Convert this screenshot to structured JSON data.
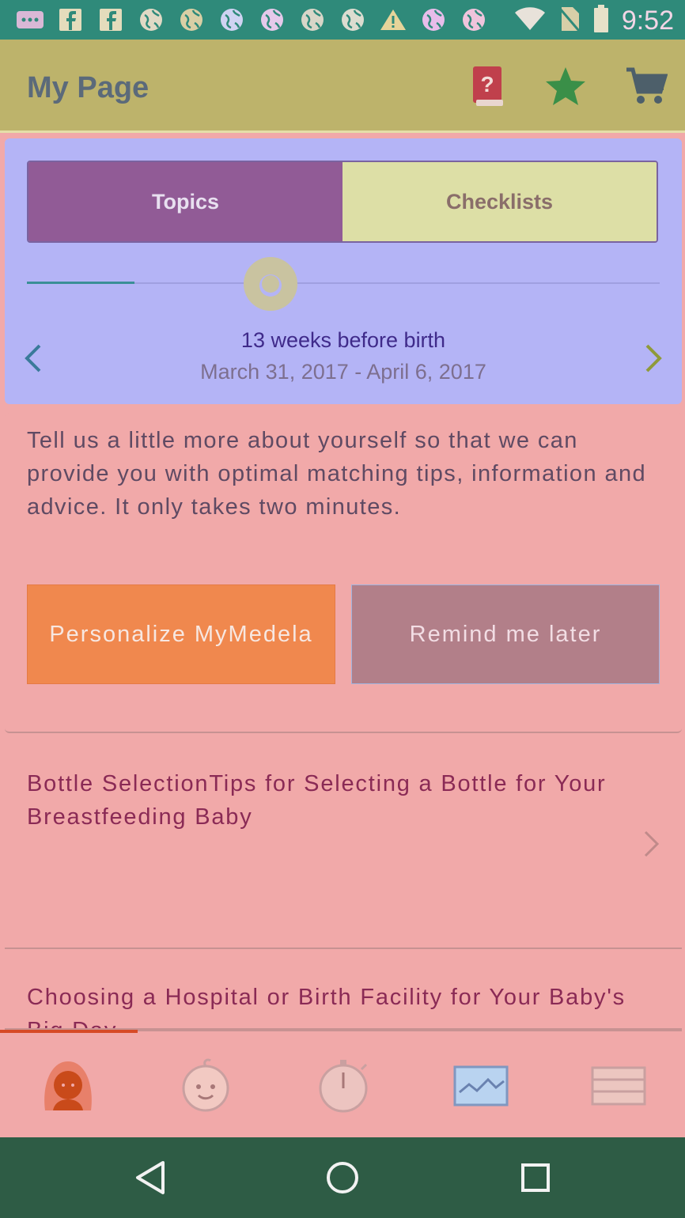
{
  "status_bar": {
    "time": "9:52",
    "icons": [
      "message-icon",
      "facebook-icon",
      "facebook-icon",
      "globe-icon",
      "globe-icon",
      "globe-icon",
      "globe-icon",
      "globe-icon",
      "globe-icon",
      "warning-icon",
      "globe-icon",
      "globe-icon",
      "wifi-icon",
      "no-sim-icon",
      "battery-icon"
    ]
  },
  "app_bar": {
    "title": "My Page",
    "actions": [
      "help-book-icon",
      "star-icon",
      "cart-icon"
    ]
  },
  "timeline": {
    "tabs": [
      {
        "label": "Topics",
        "selected": true
      },
      {
        "label": "Checklists",
        "selected": false
      }
    ],
    "week_title": "13 weeks before birth",
    "week_range": "March 31, 2017 - April 6, 2017"
  },
  "personalize": {
    "text": "Tell us a little more about yourself so that we can provide you with optimal matching tips, information and advice. It only takes two minutes.",
    "primary_button": "Personalize MyMedela",
    "secondary_button": "Remind me later"
  },
  "articles": [
    {
      "title": "Bottle SelectionTips for Selecting a Bottle for Your Breastfeeding Baby"
    },
    {
      "title": "Choosing a Hospital or Birth Facility for Your Baby's Big Day"
    }
  ],
  "bottom_nav": {
    "tabs": [
      "mother-icon",
      "baby-icon",
      "timer-icon",
      "chart-icon",
      "menu-icon"
    ],
    "active": "mother-icon"
  },
  "colors": {
    "status_bar": "#2f8a7a",
    "app_bar": "#bdb36b",
    "timeline_bg": "#b4b4f6",
    "content_bg": "#f1a9a9",
    "primary_button": "#f0884e",
    "secondary_button": "#b27f89",
    "system_nav": "#2e5c45"
  }
}
